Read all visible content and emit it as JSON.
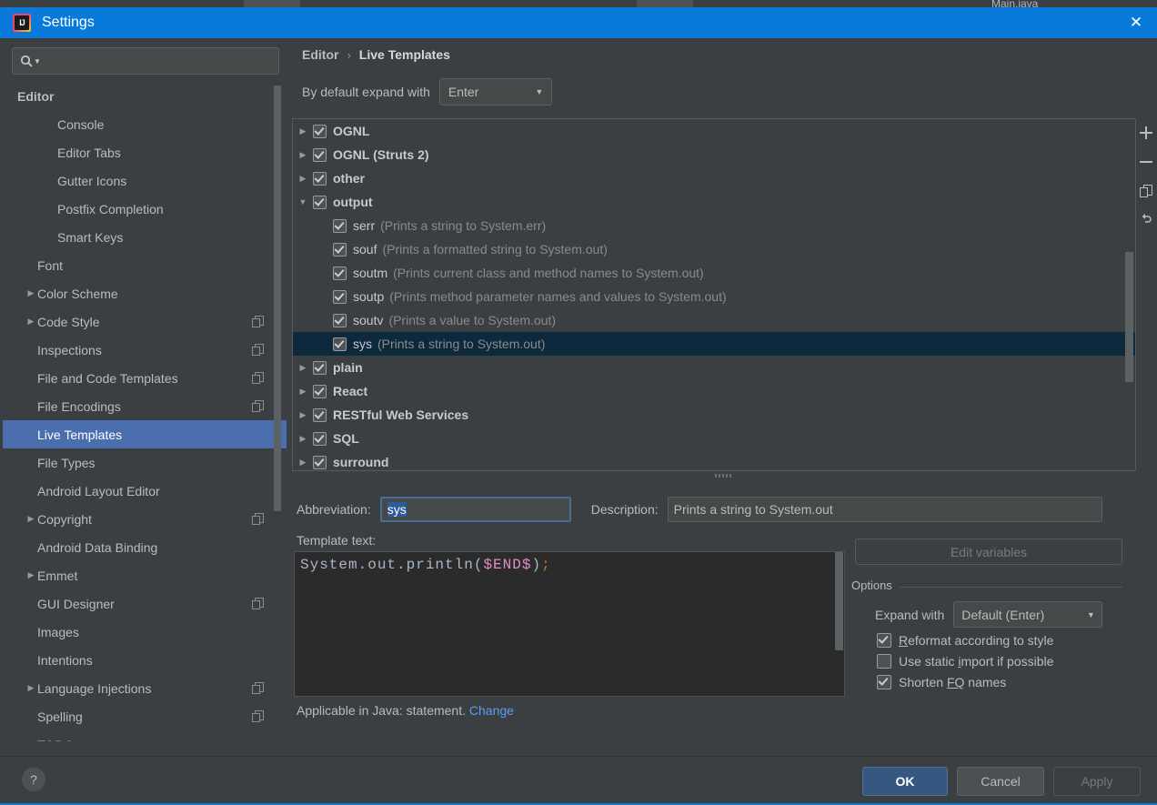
{
  "background": {
    "tab_label": "Main.java"
  },
  "titlebar": {
    "logo": "intellij-logo",
    "title": "Settings",
    "close_label": "✕"
  },
  "sidebar": {
    "search": {
      "placeholder": "",
      "value": "",
      "icon": "search-icon",
      "caret": "▼"
    },
    "items": [
      {
        "label": "Editor",
        "indent": 0,
        "arrow": "",
        "group": true,
        "selected": false,
        "copyable": false
      },
      {
        "label": "Console",
        "indent": 2,
        "arrow": "",
        "group": false,
        "selected": false,
        "copyable": false
      },
      {
        "label": "Editor Tabs",
        "indent": 2,
        "arrow": "",
        "group": false,
        "selected": false,
        "copyable": false
      },
      {
        "label": "Gutter Icons",
        "indent": 2,
        "arrow": "",
        "group": false,
        "selected": false,
        "copyable": false
      },
      {
        "label": "Postfix Completion",
        "indent": 2,
        "arrow": "",
        "group": false,
        "selected": false,
        "copyable": false
      },
      {
        "label": "Smart Keys",
        "indent": 2,
        "arrow": "",
        "group": false,
        "selected": false,
        "copyable": false
      },
      {
        "label": "Font",
        "indent": 1,
        "arrow": "",
        "group": false,
        "selected": false,
        "copyable": false
      },
      {
        "label": "Color Scheme",
        "indent": 1,
        "arrow": "▶",
        "group": false,
        "selected": false,
        "copyable": false
      },
      {
        "label": "Code Style",
        "indent": 1,
        "arrow": "▶",
        "group": false,
        "selected": false,
        "copyable": true
      },
      {
        "label": "Inspections",
        "indent": 1,
        "arrow": "",
        "group": false,
        "selected": false,
        "copyable": true
      },
      {
        "label": "File and Code Templates",
        "indent": 1,
        "arrow": "",
        "group": false,
        "selected": false,
        "copyable": true
      },
      {
        "label": "File Encodings",
        "indent": 1,
        "arrow": "",
        "group": false,
        "selected": false,
        "copyable": true
      },
      {
        "label": "Live Templates",
        "indent": 1,
        "arrow": "",
        "group": false,
        "selected": true,
        "copyable": false
      },
      {
        "label": "File Types",
        "indent": 1,
        "arrow": "",
        "group": false,
        "selected": false,
        "copyable": false
      },
      {
        "label": "Android Layout Editor",
        "indent": 1,
        "arrow": "",
        "group": false,
        "selected": false,
        "copyable": false
      },
      {
        "label": "Copyright",
        "indent": 1,
        "arrow": "▶",
        "group": false,
        "selected": false,
        "copyable": true
      },
      {
        "label": "Android Data Binding",
        "indent": 1,
        "arrow": "",
        "group": false,
        "selected": false,
        "copyable": false
      },
      {
        "label": "Emmet",
        "indent": 1,
        "arrow": "▶",
        "group": false,
        "selected": false,
        "copyable": false
      },
      {
        "label": "GUI Designer",
        "indent": 1,
        "arrow": "",
        "group": false,
        "selected": false,
        "copyable": true
      },
      {
        "label": "Images",
        "indent": 1,
        "arrow": "",
        "group": false,
        "selected": false,
        "copyable": false
      },
      {
        "label": "Intentions",
        "indent": 1,
        "arrow": "",
        "group": false,
        "selected": false,
        "copyable": false
      },
      {
        "label": "Language Injections",
        "indent": 1,
        "arrow": "▶",
        "group": false,
        "selected": false,
        "copyable": true
      },
      {
        "label": "Spelling",
        "indent": 1,
        "arrow": "",
        "group": false,
        "selected": false,
        "copyable": true
      },
      {
        "label": "TODO",
        "indent": 1,
        "arrow": "",
        "group": false,
        "selected": false,
        "copyable": false
      }
    ]
  },
  "content": {
    "breadcrumb": {
      "parent": "Editor",
      "separator": "›",
      "current": "Live Templates"
    },
    "expand_with": {
      "label": "By default expand with",
      "value": "Enter",
      "arrow": "▼"
    },
    "toolbar": [
      {
        "name": "add-template-button",
        "icon": "plus-icon"
      },
      {
        "name": "remove-template-button",
        "icon": "minus-icon"
      },
      {
        "name": "duplicate-template-button",
        "icon": "copy-icon"
      },
      {
        "name": "revert-template-button",
        "icon": "undo-icon"
      }
    ],
    "templates": [
      {
        "arrow": "▶",
        "checked": true,
        "name": "OGNL",
        "desc": "",
        "leaf": false,
        "selected": false
      },
      {
        "arrow": "▶",
        "checked": true,
        "name": "OGNL (Struts 2)",
        "desc": "",
        "leaf": false,
        "selected": false
      },
      {
        "arrow": "▶",
        "checked": true,
        "name": "other",
        "desc": "",
        "leaf": false,
        "selected": false
      },
      {
        "arrow": "▼",
        "checked": true,
        "name": "output",
        "desc": "",
        "leaf": false,
        "selected": false
      },
      {
        "arrow": "",
        "checked": true,
        "name": "serr",
        "desc": "(Prints a string to System.err)",
        "leaf": true,
        "selected": false
      },
      {
        "arrow": "",
        "checked": true,
        "name": "souf",
        "desc": "(Prints a formatted string to System.out)",
        "leaf": true,
        "selected": false
      },
      {
        "arrow": "",
        "checked": true,
        "name": "soutm",
        "desc": "(Prints current class and method names to System.out)",
        "leaf": true,
        "selected": false
      },
      {
        "arrow": "",
        "checked": true,
        "name": "soutp",
        "desc": "(Prints method parameter names and values to System.out)",
        "leaf": true,
        "selected": false
      },
      {
        "arrow": "",
        "checked": true,
        "name": "soutv",
        "desc": "(Prints a value to System.out)",
        "leaf": true,
        "selected": false
      },
      {
        "arrow": "",
        "checked": true,
        "name": "sys",
        "desc": "(Prints a string to System.out)",
        "leaf": true,
        "selected": true
      },
      {
        "arrow": "▶",
        "checked": true,
        "name": "plain",
        "desc": "",
        "leaf": false,
        "selected": false
      },
      {
        "arrow": "▶",
        "checked": true,
        "name": "React",
        "desc": "",
        "leaf": false,
        "selected": false
      },
      {
        "arrow": "▶",
        "checked": true,
        "name": "RESTful Web Services",
        "desc": "",
        "leaf": false,
        "selected": false
      },
      {
        "arrow": "▶",
        "checked": true,
        "name": "SQL",
        "desc": "",
        "leaf": false,
        "selected": false
      },
      {
        "arrow": "▶",
        "checked": true,
        "name": "surround",
        "desc": "",
        "leaf": false,
        "selected": false
      }
    ]
  },
  "detail": {
    "abbreviation_label": "Abbreviation:",
    "abbreviation_value": "sys",
    "description_label": "Description:",
    "description_value": "Prints a string to System.out",
    "template_text_label": "Template text:",
    "template_code": {
      "prefix": "System.out.println(",
      "variable": "$END$",
      "suffix": ")",
      "terminator": ";"
    },
    "applicable_text": "Applicable in Java: statement.",
    "applicable_link": "Change",
    "edit_variables_label": "Edit variables",
    "options": {
      "legend": "Options",
      "expand_with_label": "Expand with",
      "expand_with_value": "Default (Enter)",
      "arrow": "▼",
      "checkboxes": [
        {
          "label_pre": "",
          "mnemonic": "R",
          "label_post": "eformat according to style",
          "checked": true
        },
        {
          "label_pre": "Use static ",
          "mnemonic": "i",
          "label_post": "mport if possible",
          "checked": false
        },
        {
          "label_pre": "Shorten ",
          "mnemonic": "FQ",
          "label_post": " names",
          "checked": true
        }
      ]
    }
  },
  "footer": {
    "help_label": "?",
    "ok_label": "OK",
    "cancel_label": "Cancel",
    "apply_label": "Apply"
  },
  "colors": {
    "title_blue": "#0a7ada",
    "selection_blue": "#4b6eaf",
    "tree_selection": "#0d293e",
    "link_blue": "#589df6",
    "ok_button": "#365880",
    "panel_bg": "#3c3f41",
    "editor_bg": "#2b2b2b"
  }
}
